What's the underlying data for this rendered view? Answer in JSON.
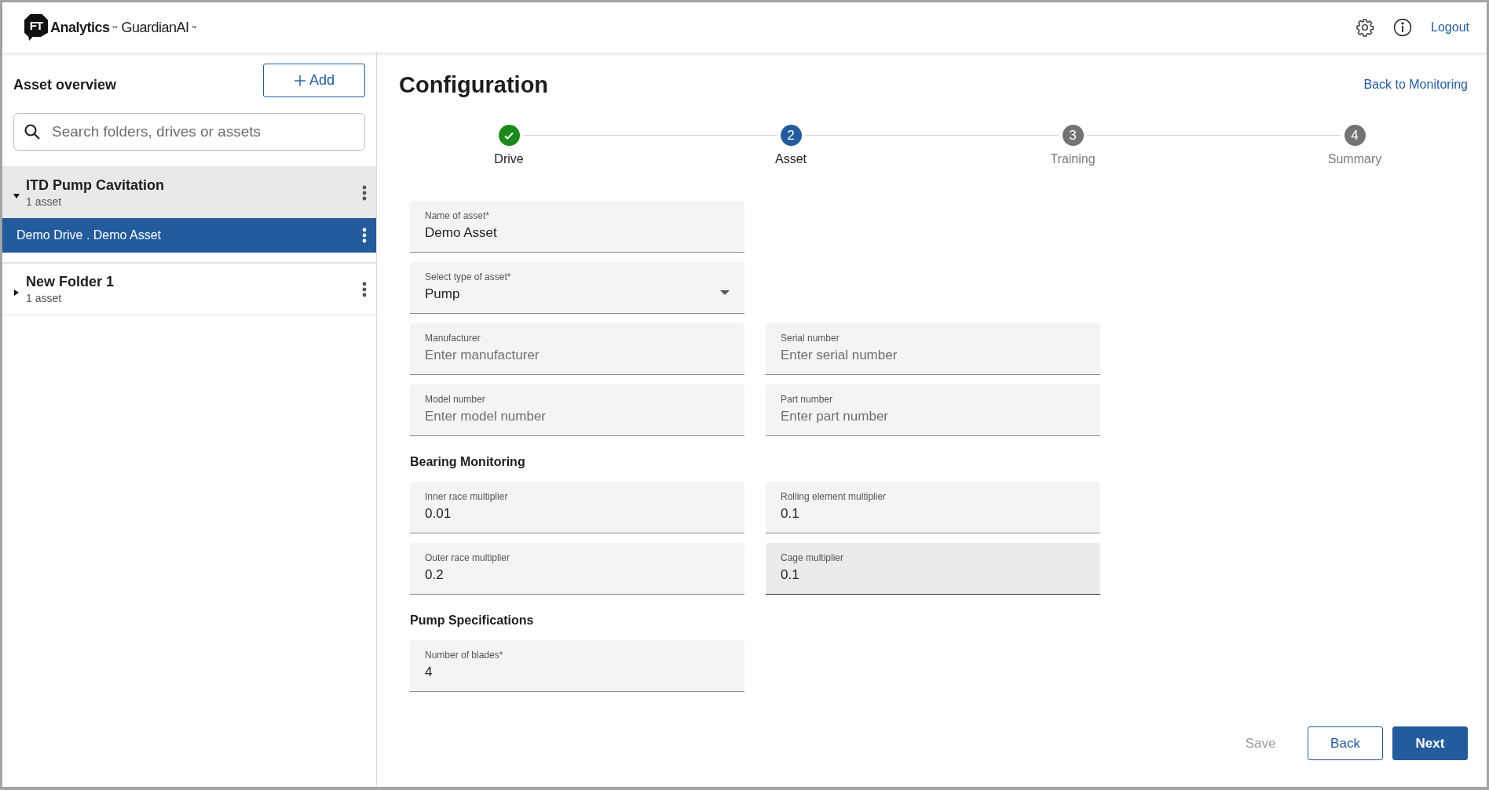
{
  "header": {
    "logo": {
      "badge": "FT",
      "brand": "Analytics",
      "brand_tm": "™",
      "product": "GuardianAI",
      "product_tm": "™"
    },
    "logout": "Logout"
  },
  "sidebar": {
    "title": "Asset overview",
    "add_button": "Add",
    "search": {
      "placeholder": "Search folders, drives or assets"
    },
    "folders": [
      {
        "name": "ITD Pump Cavitation",
        "count": "1 asset",
        "expanded": true,
        "children": [
          {
            "name": "Demo Drive . Demo Asset",
            "selected": true
          }
        ]
      },
      {
        "name": "New Folder 1",
        "count": "1 asset",
        "expanded": false
      }
    ]
  },
  "main": {
    "title": "Configuration",
    "back_link": "Back to Monitoring",
    "steps": [
      {
        "label": "Drive",
        "completed": true,
        "selected": false
      },
      {
        "number": "2",
        "label": "Asset",
        "completed": false,
        "selected": true
      },
      {
        "number": "3",
        "label": "Training",
        "completed": false,
        "selected": false
      },
      {
        "number": "4",
        "label": "Summary",
        "completed": false,
        "selected": false
      }
    ],
    "sections": [
      {
        "rows": [
          [
            {
              "kind": "text",
              "label": "Name of asset*",
              "value": "Demo Asset",
              "highlighted": false
            }
          ],
          [
            {
              "kind": "select",
              "label": "Select type of asset*",
              "value": "Pump",
              "highlighted": false
            }
          ],
          [
            {
              "kind": "text",
              "label": "Manufacturer",
              "placeholder": "Enter manufacturer",
              "highlighted": false
            },
            {
              "kind": "text",
              "label": "Serial number",
              "placeholder": "Enter serial number",
              "highlighted": false
            }
          ],
          [
            {
              "kind": "text",
              "label": "Model number",
              "placeholder": "Enter model number",
              "highlighted": false
            },
            {
              "kind": "text",
              "label": "Part number",
              "placeholder": "Enter part number",
              "highlighted": false
            }
          ]
        ]
      },
      {
        "title": "Bearing Monitoring",
        "rows": [
          [
            {
              "kind": "text",
              "label": "Inner race multiplier",
              "value": "0.01",
              "highlighted": false
            },
            {
              "kind": "text",
              "label": "Rolling element multiplier",
              "value": "0.1",
              "highlighted": false
            }
          ],
          [
            {
              "kind": "text",
              "label": "Outer race multiplier",
              "value": "0.2",
              "highlighted": false
            },
            {
              "kind": "text",
              "label": "Cage multiplier",
              "value": "0.1",
              "highlighted": true
            }
          ]
        ]
      },
      {
        "title": "Pump Specifications",
        "rows": [
          [
            {
              "kind": "text",
              "label": "Number of blades*",
              "value": "4",
              "highlighted": false
            }
          ]
        ]
      }
    ],
    "buttons": [
      {
        "kind": "text",
        "label": "Save",
        "disabled": true
      },
      {
        "kind": "outline",
        "label": "Back",
        "disabled": false
      },
      {
        "kind": "primary",
        "label": "Next",
        "disabled": false
      }
    ]
  }
}
